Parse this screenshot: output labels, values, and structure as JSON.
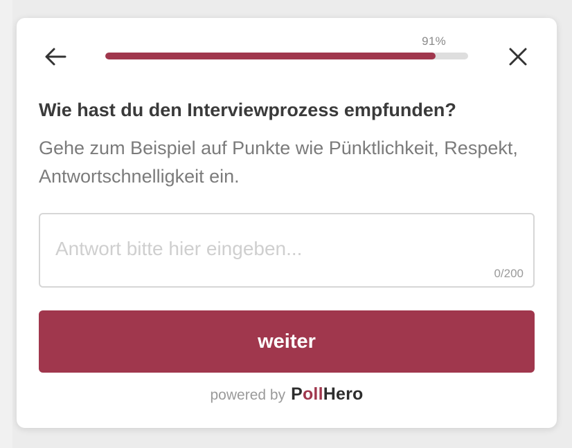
{
  "progress": {
    "percent_label": "91%",
    "fraction": 0.91
  },
  "question": {
    "title": "Wie hast du den Interviewprozess empfunden?",
    "hint": "Gehe zum Beispiel auf Punkte wie Pünktlichkeit, Respekt, Antwortschnelligkeit ein."
  },
  "answer": {
    "value": "",
    "placeholder": "Antwort bitte hier eingeben...",
    "counter": "0/200"
  },
  "actions": {
    "next_label": "weiter"
  },
  "footer": {
    "powered_by": "powered by",
    "brand_prefix": "P",
    "brand_accent": "oll",
    "brand_suffix": "Hero"
  },
  "colors": {
    "accent": "#a0374d",
    "track": "#dedede"
  },
  "icons": {
    "back": "arrow-left-icon",
    "close": "close-icon"
  }
}
